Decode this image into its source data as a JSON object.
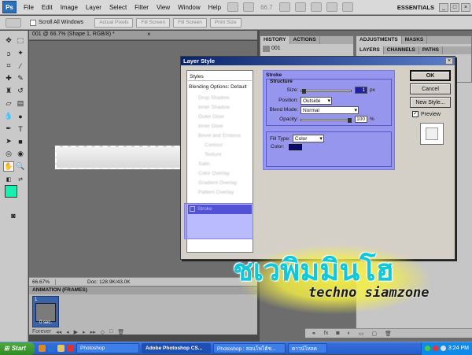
{
  "app": {
    "logo": "Ps"
  },
  "menu": [
    "File",
    "Edit",
    "Image",
    "Layer",
    "Select",
    "Filter",
    "View",
    "Window",
    "Help"
  ],
  "menubar_zoom": "66.7",
  "workspace": "ESSENTIALS",
  "window_controls": [
    "_",
    "□",
    "×"
  ],
  "options_bar": {
    "scroll_all_windows": "Scroll All Windows",
    "buttons": [
      "Actual Pixels",
      "Fill Screen",
      "Fill Screen",
      "Print Size"
    ]
  },
  "document": {
    "tab": "001 @ 66.7% (Shape 1, RGB/8) *",
    "close": "×",
    "zoom": "66.67%",
    "doc_size": "Doc: 128.9K/43.0K"
  },
  "animation": {
    "tab": "ANIMATION (FRAMES)",
    "frame_label": "1",
    "frame_time": "0 sec.",
    "loop": "Forever",
    "controls": [
      "◂◂",
      "◂",
      "▶",
      "▸",
      "▸▸",
      "◇",
      "□",
      "🗑"
    ]
  },
  "history": {
    "tabs": [
      "HISTORY",
      "ACTIONS"
    ],
    "item": "001"
  },
  "adjustments": {
    "tabs": [
      "ADJUSTMENTS",
      "MASKS"
    ]
  },
  "layers": {
    "tabs": [
      "LAYERS",
      "CHANNELS",
      "PATHS"
    ]
  },
  "dialog": {
    "title": "Layer Style",
    "close": "×",
    "styles_header": "Styles",
    "styles": [
      {
        "label": "Blending Options: Default",
        "blurred": false
      },
      {
        "label": "Drop Shadow",
        "blurred": true
      },
      {
        "label": "Inner Shadow",
        "blurred": true
      },
      {
        "label": "Outer Glow",
        "blurred": true
      },
      {
        "label": "Inner Glow",
        "blurred": true
      },
      {
        "label": "Bevel and Emboss",
        "blurred": true
      },
      {
        "label": "Contour",
        "blurred": true
      },
      {
        "label": "Texture",
        "blurred": true
      },
      {
        "label": "Satin",
        "blurred": true
      },
      {
        "label": "Color Overlay",
        "blurred": true
      },
      {
        "label": "Gradient Overlay",
        "blurred": true
      },
      {
        "label": "Pattern Overlay",
        "blurred": true
      }
    ],
    "selected_style": "Stroke",
    "stroke": {
      "title": "Stroke",
      "structure": "Structure",
      "size_label": "Size:",
      "size_value": "1",
      "size_unit": "px",
      "position_label": "Position:",
      "position_value": "Outside",
      "blend_label": "Blend Mode:",
      "blend_value": "Normal",
      "opacity_label": "Opacity:",
      "opacity_value": "100",
      "opacity_unit": "%",
      "fill_type_label": "Fill Type:",
      "fill_type_value": "Color",
      "color_label": "Color:",
      "color_hex": "#0b0b6e"
    },
    "buttons": {
      "ok": "OK",
      "cancel": "Cancel",
      "new_style": "New Style..."
    },
    "preview_label": "Preview",
    "preview_checked": true
  },
  "watermark": {
    "thai": "ชเวพิมมินโฮ",
    "english": "techno siamzone"
  },
  "taskbar": {
    "start": "Start",
    "tasks": [
      {
        "label": "Photoshop",
        "active": false
      },
      {
        "label": "Adobe Photoshop CS...",
        "active": true
      },
      {
        "label": "Photoshop : สอนโฟโต้ช...",
        "active": false
      },
      {
        "label": "ดาวน์โหลด",
        "active": false
      }
    ],
    "time": "3:24 PM"
  },
  "colors": {
    "foreground": "#18f0b0",
    "background": "#ffffff",
    "accent": "#0a246a"
  }
}
